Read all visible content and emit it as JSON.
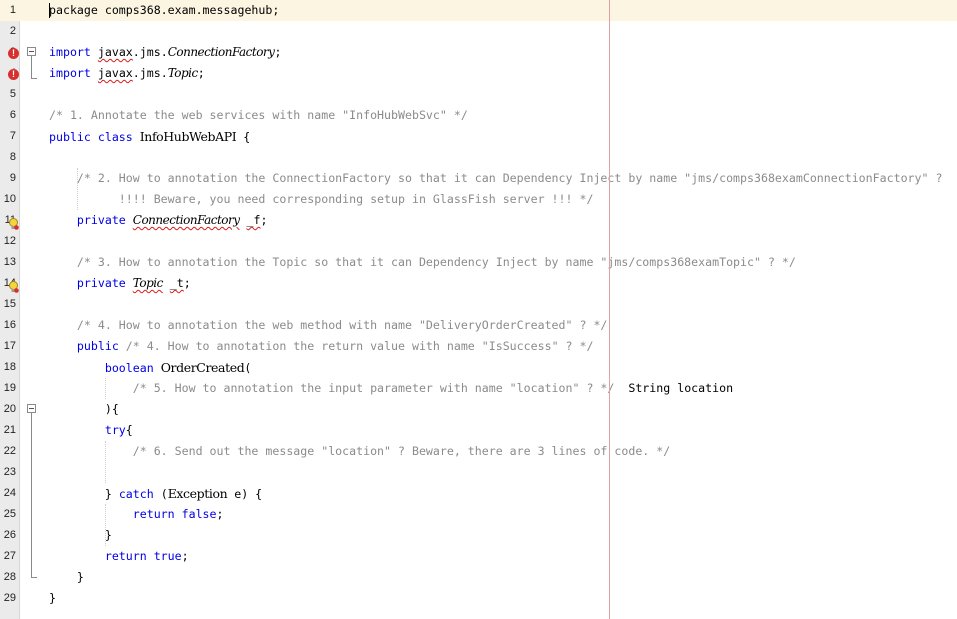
{
  "editor": {
    "lines": [
      {
        "n": "1",
        "segs": [
          {
            "t": "package comps368.exam.messagehub;",
            "c": ""
          }
        ]
      },
      {
        "n": "2",
        "segs": []
      },
      {
        "n": "3",
        "segs": [
          {
            "t": "import ",
            "c": "kw"
          },
          {
            "t": "javax",
            "c": "squig"
          },
          {
            "t": ".jms.",
            "c": ""
          },
          {
            "t": "ConnectionFactory",
            "c": "it"
          },
          {
            "t": ";",
            "c": ""
          }
        ]
      },
      {
        "n": "4",
        "segs": [
          {
            "t": "import ",
            "c": "kw"
          },
          {
            "t": "javax",
            "c": "squig"
          },
          {
            "t": ".jms.",
            "c": ""
          },
          {
            "t": "Topic",
            "c": "it"
          },
          {
            "t": ";",
            "c": ""
          }
        ]
      },
      {
        "n": "5",
        "segs": []
      },
      {
        "n": "6",
        "segs": [
          {
            "t": "/* 1. Annotate the web services with name \"InfoHubWebSvc\" */",
            "c": "cm"
          }
        ]
      },
      {
        "n": "7",
        "segs": [
          {
            "t": "public class ",
            "c": "kw"
          },
          {
            "t": "InfoHubWebAPI",
            "c": "sym"
          },
          {
            "t": " {",
            "c": ""
          }
        ]
      },
      {
        "n": "8",
        "segs": []
      },
      {
        "n": "9",
        "segs": [
          {
            "t": "    /* 2. How to annotation the ConnectionFactory so that it can Dependency Inject by name \"jms/comps368examConnectionFactory\" ?",
            "c": "cm"
          }
        ]
      },
      {
        "n": "10",
        "segs": [
          {
            "t": "          !!!! Beware, you need corresponding setup in GlassFish server !!! */",
            "c": "cm"
          }
        ]
      },
      {
        "n": "11",
        "segs": [
          {
            "t": "    private ",
            "c": "kw"
          },
          {
            "t": "ConnectionFactory",
            "c": "it squig"
          },
          {
            "t": " ",
            "c": ""
          },
          {
            "t": "_f",
            "c": "squig"
          },
          {
            "t": ";",
            "c": ""
          }
        ]
      },
      {
        "n": "12",
        "segs": []
      },
      {
        "n": "13",
        "segs": [
          {
            "t": "    /* 3. How to annotation the Topic so that it can Dependency Inject by name \"jms/comps368examTopic\" ? */",
            "c": "cm"
          }
        ]
      },
      {
        "n": "14",
        "segs": [
          {
            "t": "    private ",
            "c": "kw"
          },
          {
            "t": "Topic",
            "c": "it squig"
          },
          {
            "t": " ",
            "c": ""
          },
          {
            "t": "_t",
            "c": "squig"
          },
          {
            "t": ";",
            "c": ""
          }
        ]
      },
      {
        "n": "15",
        "segs": []
      },
      {
        "n": "16",
        "segs": [
          {
            "t": "    /* 4. How to annotation the web method with name \"DeliveryOrderCreated\" ? */",
            "c": "cm"
          }
        ]
      },
      {
        "n": "17",
        "segs": [
          {
            "t": "    public ",
            "c": "kw"
          },
          {
            "t": "/* 4. How to annotation the return value with name \"IsSuccess\" ? */",
            "c": "cm"
          }
        ]
      },
      {
        "n": "18",
        "segs": [
          {
            "t": "        boolean ",
            "c": "kw"
          },
          {
            "t": "OrderCreated",
            "c": "sym"
          },
          {
            "t": "(",
            "c": ""
          }
        ]
      },
      {
        "n": "19",
        "segs": [
          {
            "t": "            /* 5. How to annotation the input parameter with name \"location\" ? */",
            "c": "cm"
          },
          {
            "t": "  String location",
            "c": ""
          }
        ]
      },
      {
        "n": "20",
        "segs": [
          {
            "t": "        ){",
            "c": ""
          }
        ]
      },
      {
        "n": "21",
        "segs": [
          {
            "t": "        try",
            "c": "kw"
          },
          {
            "t": "{",
            "c": ""
          }
        ]
      },
      {
        "n": "22",
        "segs": [
          {
            "t": "            /* 6. Send out the message \"location\" ? Beware, there are 3 lines of code. */",
            "c": "cm"
          }
        ]
      },
      {
        "n": "23",
        "segs": []
      },
      {
        "n": "24",
        "segs": [
          {
            "t": "        } ",
            "c": ""
          },
          {
            "t": "catch",
            "c": "kw"
          },
          {
            "t": " (",
            "c": ""
          },
          {
            "t": "Exception",
            "c": "sym"
          },
          {
            "t": " e) {",
            "c": ""
          }
        ]
      },
      {
        "n": "25",
        "segs": [
          {
            "t": "            return false",
            "c": "kw"
          },
          {
            "t": ";",
            "c": ""
          }
        ]
      },
      {
        "n": "26",
        "segs": [
          {
            "t": "        }",
            "c": ""
          }
        ]
      },
      {
        "n": "27",
        "segs": [
          {
            "t": "        return true",
            "c": "kw"
          },
          {
            "t": ";",
            "c": ""
          }
        ]
      },
      {
        "n": "28",
        "segs": [
          {
            "t": "    }",
            "c": ""
          }
        ]
      },
      {
        "n": "29",
        "segs": [
          {
            "t": "}",
            "c": ""
          }
        ]
      }
    ],
    "error_badge": "!",
    "current_line": "1"
  }
}
